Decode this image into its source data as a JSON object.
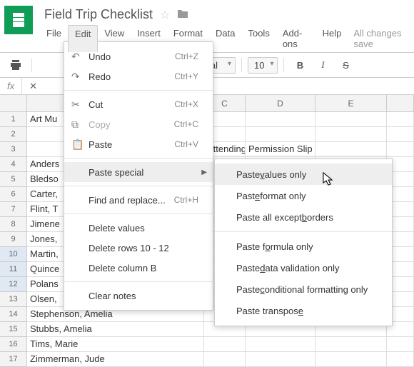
{
  "doc": {
    "title": "Field Trip Checklist",
    "save_status": "All changes save"
  },
  "menubar": [
    "File",
    "Edit",
    "View",
    "Insert",
    "Format",
    "Data",
    "Tools",
    "Add-ons",
    "Help"
  ],
  "toolbar": {
    "font": "Arial",
    "size": "10",
    "bold": "B",
    "italic": "I",
    "strike": "S"
  },
  "cols": {
    "c": "C",
    "d": "D",
    "e": "E"
  },
  "headers": {
    "attending": "Attending",
    "permission": "Permission Slip Returned"
  },
  "rows": [
    {
      "n": "1",
      "a": "Art Mu"
    },
    {
      "n": "2",
      "a": ""
    },
    {
      "n": "3",
      "a": ""
    },
    {
      "n": "4",
      "a": "Anders"
    },
    {
      "n": "5",
      "a": "Bledso"
    },
    {
      "n": "6",
      "a": "Carter,"
    },
    {
      "n": "7",
      "a": "Flint, T"
    },
    {
      "n": "8",
      "a": "Jimene"
    },
    {
      "n": "9",
      "a": "Jones,"
    },
    {
      "n": "10",
      "a": "Martin,"
    },
    {
      "n": "11",
      "a": "Quince"
    },
    {
      "n": "12",
      "a": "Polans"
    },
    {
      "n": "13",
      "a": "Olsen,"
    },
    {
      "n": "14",
      "a": "Stephenson, Amelia"
    },
    {
      "n": "15",
      "a": "Stubbs, Amelia"
    },
    {
      "n": "16",
      "a": "Tims, Marie"
    },
    {
      "n": "17",
      "a": "Zimmerman, Jude"
    }
  ],
  "edit_menu": {
    "undo": "Undo",
    "undo_s": "Ctrl+Z",
    "redo": "Redo",
    "redo_s": "Ctrl+Y",
    "cut": "Cut",
    "cut_s": "Ctrl+X",
    "copy": "Copy",
    "copy_s": "Ctrl+C",
    "paste": "Paste",
    "paste_s": "Ctrl+V",
    "paste_special": "Paste special",
    "find": "Find and replace...",
    "find_s": "Ctrl+H",
    "del_values": "Delete values",
    "del_rows": "Delete rows 10 - 12",
    "del_col": "Delete column B",
    "clear": "Clear notes"
  },
  "submenu": {
    "values": "Paste <u>v</u>alues only",
    "format": "Past<u>e</u> format only",
    "borders": "Paste all except <u>b</u>orders",
    "formula": "Paste f<u>o</u>rmula only",
    "datavalid": "Paste <u>d</u>ata validation only",
    "cond": "Paste <u>c</u>onditional formatting only",
    "transpose": "Paste transpos<u>e</u>"
  }
}
